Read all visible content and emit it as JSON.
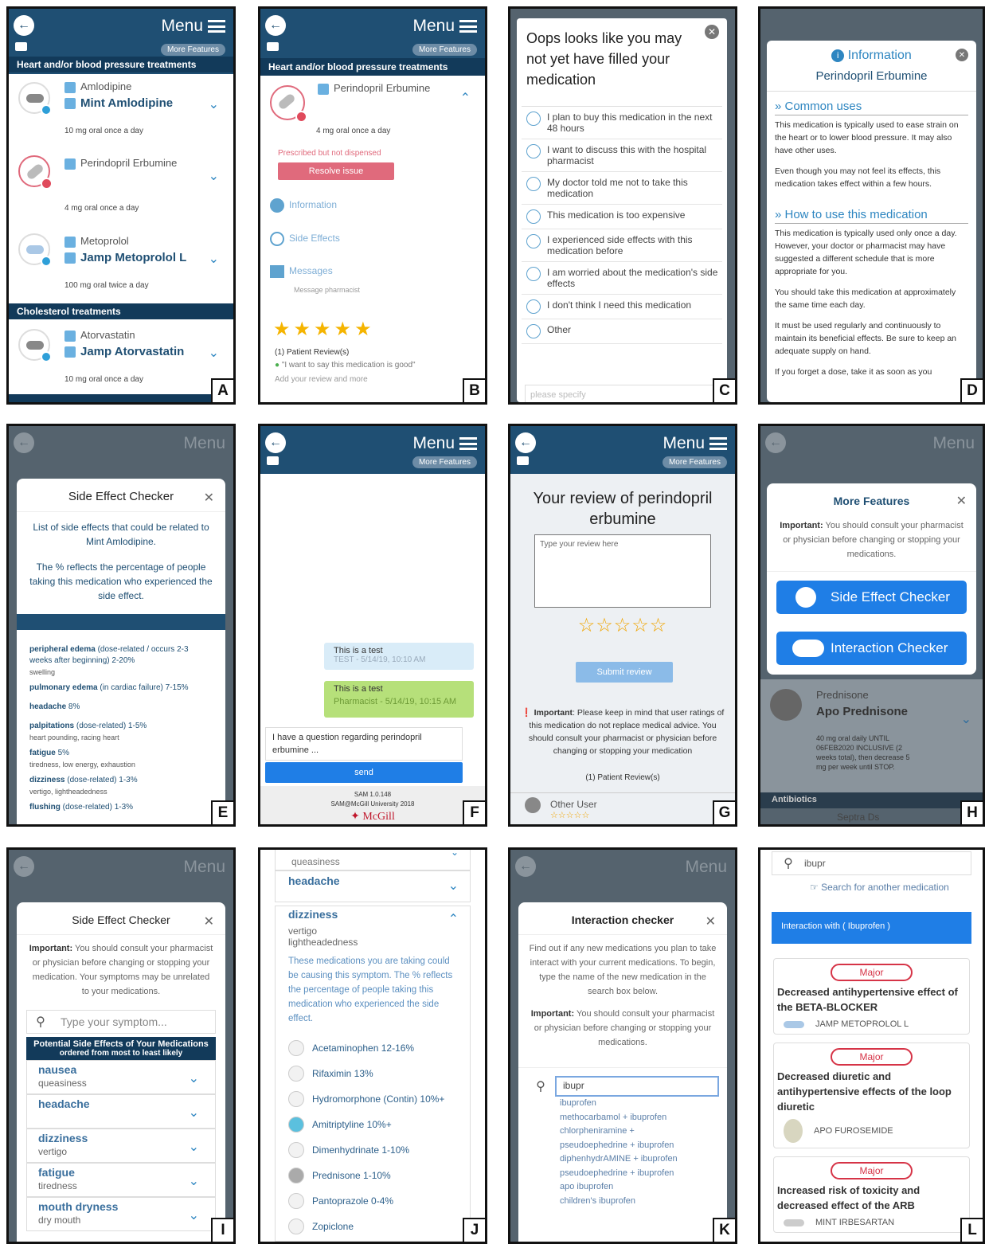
{
  "labels": [
    "A",
    "B",
    "C",
    "D",
    "E",
    "F",
    "G",
    "H",
    "I",
    "J",
    "K",
    "L"
  ],
  "appbar": {
    "menu": "Menu",
    "more_features": "More Features"
  },
  "A": {
    "section1": "Heart and/or blood pressure treatments",
    "section2": "Cholesterol treatments",
    "meds": [
      {
        "generic": "Amlodipine",
        "brand": "Mint Amlodipine",
        "dose": "10 mg oral once a day"
      },
      {
        "generic": "Perindopril Erbumine",
        "brand": "",
        "dose": "4 mg oral once a day"
      },
      {
        "generic": "Metoprolol",
        "brand": "Jamp Metoprolol L",
        "dose": "100 mg oral twice a day"
      },
      {
        "generic": "Atorvastatin",
        "brand": "Jamp Atorvastatin",
        "dose": "10 mg oral once a day"
      }
    ]
  },
  "B": {
    "section": "Heart and/or blood pressure treatments",
    "generic": "Perindopril Erbumine",
    "dose": "4 mg oral once a day",
    "status": "Prescribed but not dispensed",
    "resolve": "Resolve issue",
    "information": "Information",
    "side_effects": "Side Effects",
    "messages": "Messages",
    "message_pharmacist": "Message pharmacist",
    "reviews": "(1) Patient Review(s)",
    "quote": "\"I want to say this medication is good\"",
    "add_review": "Add your review and more"
  },
  "C": {
    "title": "Oops looks like you may not yet have filled your medication",
    "options": [
      "I plan to buy this medication in the next 48 hours",
      "I want to discuss this with the hospital pharmacist",
      "My doctor told me not to take this medication",
      "This medication is too expensive",
      "I experienced side effects with this medication before",
      "I am worried about the medication's side effects",
      "I don't think I need this medication",
      "Other"
    ],
    "placeholder": "please specify"
  },
  "D": {
    "header": "Information",
    "drug": "Perindopril Erbumine",
    "h1": "» Common uses",
    "p1": "This medication is typically used to ease strain on the heart or to lower blood pressure. It may also have other uses.",
    "p2": "Even though you may not feel its effects, this medication takes effect within a few hours.",
    "h2": "» How to use this medication",
    "p3": "This medication is typically used only once a day. However, your doctor or pharmacist may have suggested a different schedule that is more appropriate for you.",
    "p4": "You should take this medication at approximately the same time each day.",
    "p5": "It must be used regularly and continuously to maintain its beneficial effects. Be sure to keep an adequate supply on hand.",
    "p6": "If you forget a dose, take it as soon as you"
  },
  "E": {
    "title": "Side Effect Checker",
    "intro": "List of side effects that could be related to Mint Amlodipine.",
    "pct": "The % reflects the percentage of people taking this medication who experienced the side effect.",
    "items": [
      {
        "name": "peripheral edema",
        "detail": "(dose-related / occurs 2-3 weeks after beginning) 2-20%",
        "sub": "swelling"
      },
      {
        "name": "pulmonary edema",
        "detail": "(in cardiac failure) 7-15%",
        "sub": ""
      },
      {
        "name": "headache",
        "detail": "8%",
        "sub": ""
      },
      {
        "name": "palpitations",
        "detail": "(dose-related) 1-5%",
        "sub": "heart pounding, racing heart"
      },
      {
        "name": "fatigue",
        "detail": "5%",
        "sub": "tiredness, low energy, exhaustion"
      },
      {
        "name": "dizziness",
        "detail": "(dose-related) 1-3%",
        "sub": "vertigo, lightheadedness"
      },
      {
        "name": "flushing",
        "detail": "(dose-related) 1-3%",
        "sub": ""
      }
    ]
  },
  "F": {
    "msg1": "This is a test",
    "meta1": "TEST - 5/14/19, 10:10 AM",
    "msg2": "This is a test",
    "meta2": "Pharmacist - 5/14/19, 10:15 AM",
    "input": "I have a question regarding perindopril erbumine ...",
    "send": "send",
    "footer1": "SAM 1.0.148",
    "footer2": "SAM@McGill University 2018",
    "logo": "McGill"
  },
  "G": {
    "title": "Your review of perindopril erbumine",
    "placeholder": "Type your review here",
    "submit": "Submit review",
    "important_label": "Important",
    "important": ": Please keep in mind that user ratings of this medication do not replace medical advice. You should consult your pharmacist or physician before changing or stopping your medication",
    "count": "(1) Patient Review(s)",
    "user": "Other User"
  },
  "H": {
    "title": "More Features",
    "important_label": "Important:",
    "important": " You should consult your pharmacist or physician before changing or stopping your medications.",
    "btn1": "Side Effect Checker",
    "btn2": "Interaction Checker",
    "generic": "Prednisone",
    "brand": "Apo Prednisone",
    "dose": "40 mg oral daily UNTIL 06FEB2020 INCLUSIVE (2 weeks total), then decrease 5 mg per week until STOP.",
    "section": "Antibiotics",
    "next": "Septra Ds"
  },
  "I": {
    "title": "Side Effect Checker",
    "important_label": "Important:",
    "important": " You should consult your pharmacist or physician before changing or stopping your medication. Your symptoms may be unrelated to your medications.",
    "placeholder": "Type your symptom...",
    "banner1": "Potential Side Effects of Your Medications",
    "banner2": "ordered from most to least likely",
    "items": [
      {
        "name": "nausea",
        "sub": "queasiness"
      },
      {
        "name": "headache",
        "sub": ""
      },
      {
        "name": "dizziness",
        "sub": "vertigo"
      },
      {
        "name": "fatigue",
        "sub": "tiredness"
      },
      {
        "name": "mouth dryness",
        "sub": "dry mouth"
      }
    ]
  },
  "J": {
    "top": "queasiness",
    "headache": "headache",
    "dizziness": "dizziness",
    "sub1": "vertigo",
    "sub2": "lightheadedness",
    "explain": "These medications you are taking could be causing this symptom. The % reflects the percentage of people taking this medication who experienced the side effect.",
    "meds": [
      "Acetaminophen 12-16%",
      "Rifaximin 13%",
      "Hydromorphone (Contin) 10%+",
      "Amitriptyline 10%+",
      "Dimenhydrinate 1-10%",
      "Prednisone 1-10%",
      "Pantoprazole 0-4%",
      "Zopiclone"
    ]
  },
  "K": {
    "title": "Interaction checker",
    "intro": "Find out if any new medications you plan to take interact with your current medications. To begin, type the name of the new medication in the search box below.",
    "important_label": "Important:",
    "important": " You should consult your pharmacist or physician before changing or stopping your medications.",
    "query": "ibupr",
    "suggestions": [
      "ibuprofen",
      "methocarbamol + ibuprofen",
      "chlorpheniramine + pseudoephedrine + ibuprofen",
      "diphenhydrAMINE + ibuprofen",
      "pseudoephedrine + ibuprofen",
      "apo ibuprofen",
      "children's ibuprofen"
    ]
  },
  "L": {
    "query": "ibupr",
    "search_another": "Search for another medication",
    "banner": "Interaction with ( Ibuprofen )",
    "items": [
      {
        "severity": "Major",
        "text": "Decreased antihypertensive effect of the BETA-BLOCKER",
        "drug": "JAMP METOPROLOL L"
      },
      {
        "severity": "Major",
        "text": "Decreased diuretic and antihypertensive effects of the loop diuretic",
        "drug": "APO FUROSEMIDE"
      },
      {
        "severity": "Major",
        "text": "Increased risk of toxicity and decreased effect of the ARB",
        "drug": "MINT IRBESARTAN"
      }
    ]
  },
  "colors": {
    "appbar": "#1f4f73",
    "accent": "#2e86c1",
    "alert": "#e04a5c",
    "button": "#1f7ee6"
  }
}
